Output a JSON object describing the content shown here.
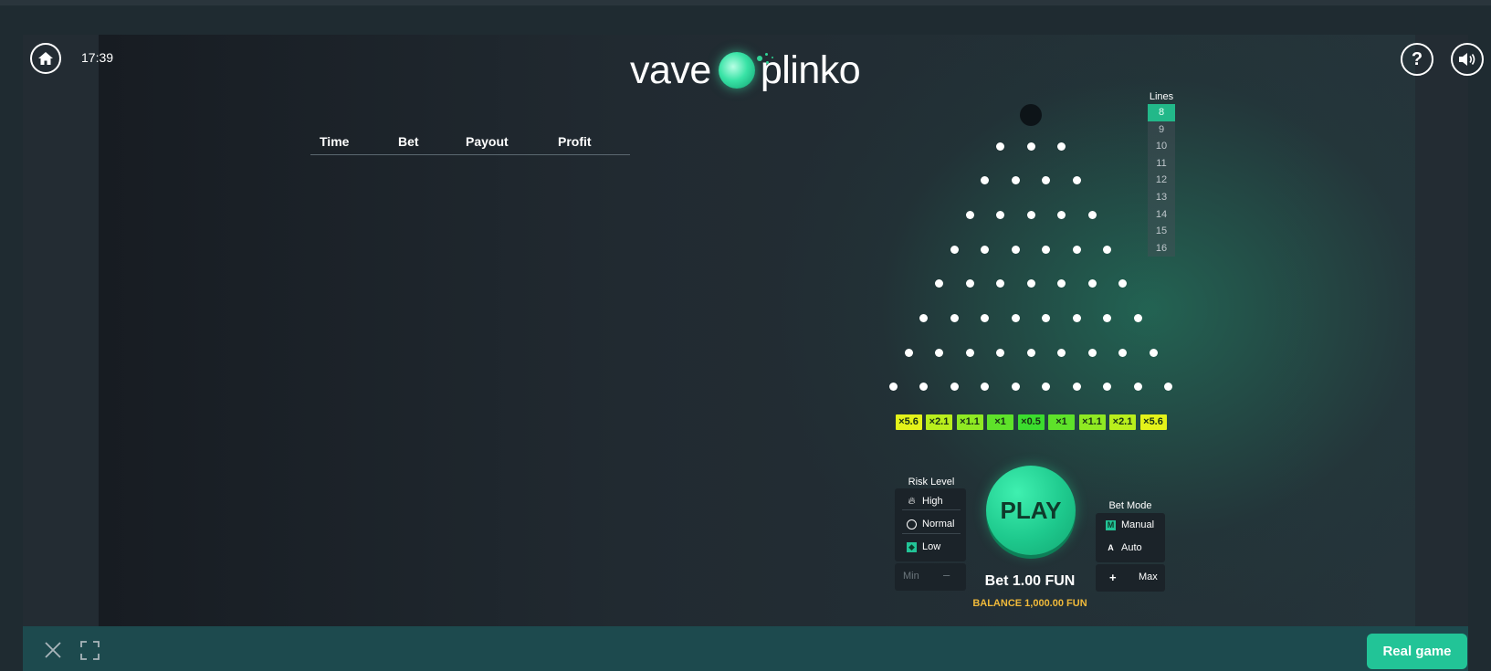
{
  "header": {
    "time": "17:39",
    "logo_left": "vave",
    "logo_right": "plinko"
  },
  "history": {
    "columns": [
      "Time",
      "Bet",
      "Payout",
      "Profit"
    ]
  },
  "lines": {
    "title": "Lines",
    "options": [
      "8",
      "9",
      "10",
      "11",
      "12",
      "13",
      "14",
      "15",
      "16"
    ],
    "selected": "8"
  },
  "multipliers": [
    {
      "label": "×5.6",
      "color": "#e4f21a"
    },
    {
      "label": "×2.1",
      "color": "#b9ee1d"
    },
    {
      "label": "×1.1",
      "color": "#8fe923"
    },
    {
      "label": "×1",
      "color": "#5ee22a"
    },
    {
      "label": "×0.5",
      "color": "#3bdc2e"
    },
    {
      "label": "×1",
      "color": "#5ee22a"
    },
    {
      "label": "×1.1",
      "color": "#8fe923"
    },
    {
      "label": "×2.1",
      "color": "#b9ee1d"
    },
    {
      "label": "×5.6",
      "color": "#e4f21a"
    }
  ],
  "risk": {
    "title": "Risk Level",
    "high": "High",
    "normal": "Normal",
    "low": "Low",
    "selected": "Low",
    "min": "Min",
    "minus": "–"
  },
  "play": {
    "label": "PLAY"
  },
  "bet": {
    "amount": "Bet 1.00 FUN",
    "balance": "BALANCE 1,000.00 FUN"
  },
  "bet_mode": {
    "title": "Bet Mode",
    "manual": "Manual",
    "manual_key": "M",
    "auto": "Auto",
    "auto_key": "A",
    "plus": "+",
    "max": "Max"
  },
  "footer": {
    "real_game": "Real game"
  },
  "colors": {
    "accent": "#22c497",
    "balance": "#f0b93a",
    "footer": "#1d4a4e"
  }
}
